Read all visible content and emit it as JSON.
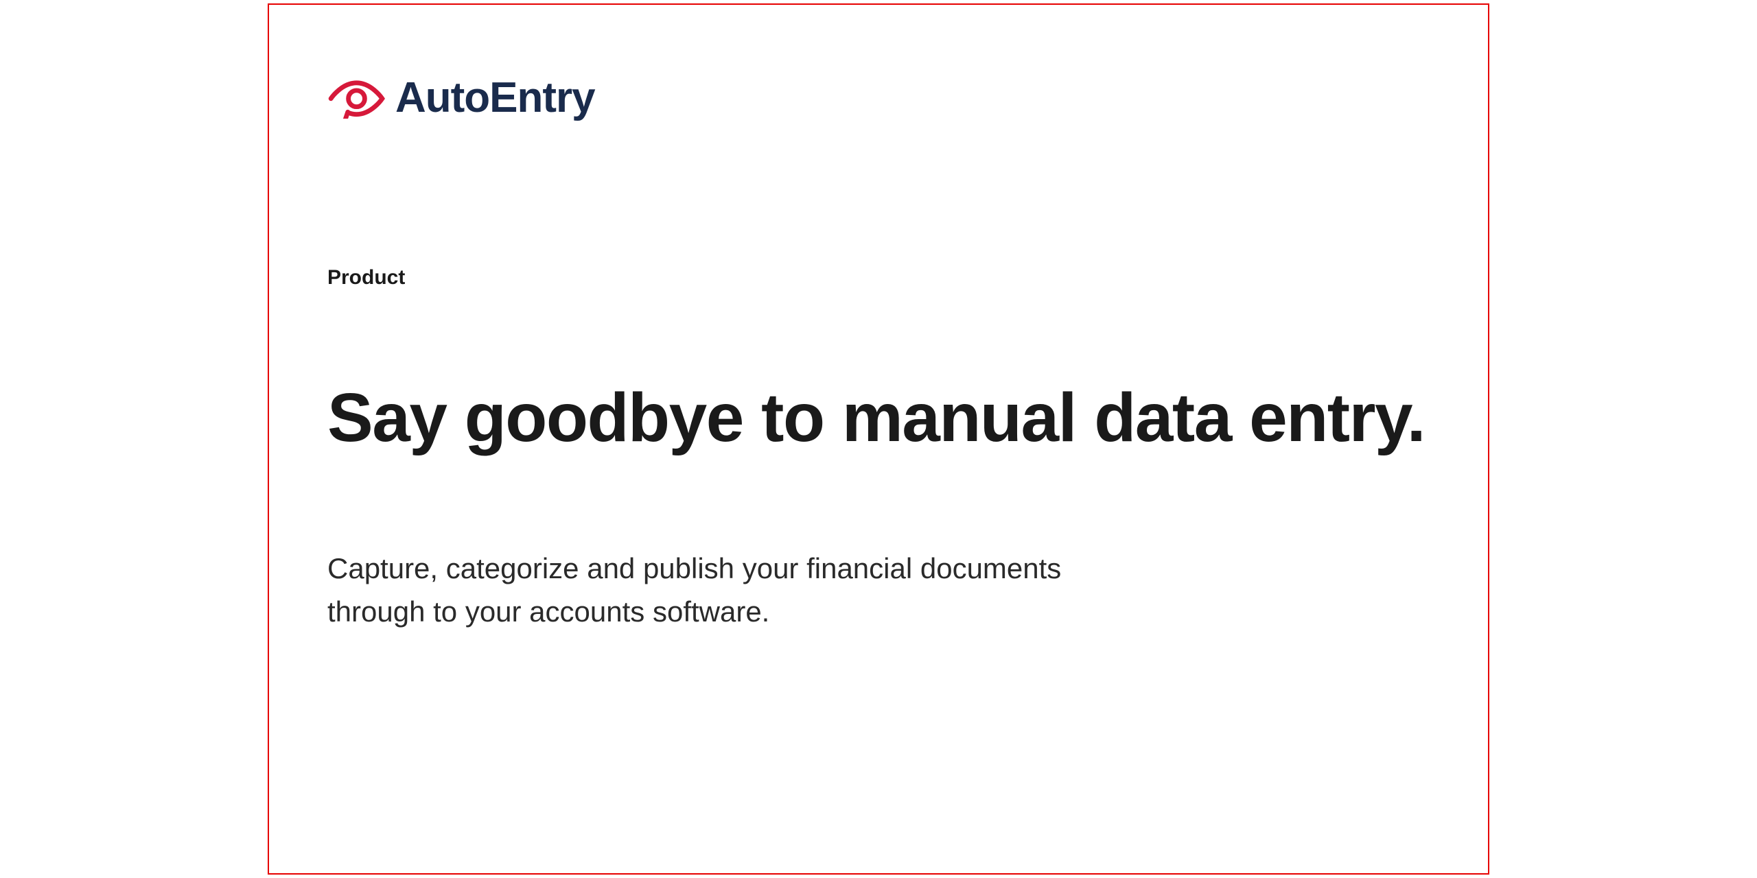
{
  "logo": {
    "brand_name": "AutoEntry"
  },
  "content": {
    "category": "Product",
    "headline": "Say goodbye to manual data entry.",
    "subtext": "Capture, categorize and publish your financial documents through to your accounts software."
  }
}
